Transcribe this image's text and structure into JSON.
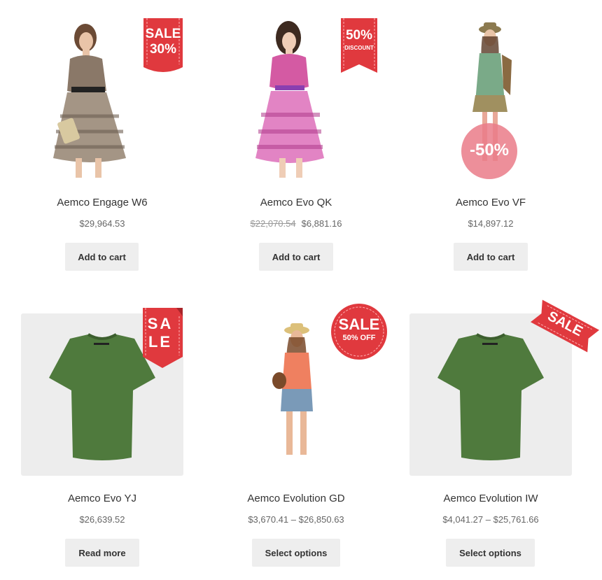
{
  "products": [
    {
      "title": "Aemco Engage W6",
      "price": "$29,964.53",
      "button": "Add to cart",
      "badge_line1": "SALE",
      "badge_line2": "30%"
    },
    {
      "title": "Aemco Evo QK",
      "old_price": "$22,070.54",
      "price": "$6,881.16",
      "button": "Add to cart",
      "badge_line1": "50%",
      "badge_line2": "DISCOUNT"
    },
    {
      "title": "Aemco Evo VF",
      "price": "$14,897.12",
      "button": "Add to cart",
      "badge_line1": "-50%"
    },
    {
      "title": "Aemco Evo YJ",
      "price": "$26,639.52",
      "button": "Read more",
      "badge_line1": "SA",
      "badge_line2": "LE"
    },
    {
      "title": "Aemco Evolution GD",
      "price": "$3,670.41 – $26,850.63",
      "button": "Select options",
      "badge_line1": "SALE",
      "badge_line2": "50% OFF"
    },
    {
      "title": "Aemco Evolution IW",
      "price": "$4,041.27 – $25,761.66",
      "button": "Select options",
      "badge_line1": "SALE"
    }
  ],
  "colors": {
    "badge_red": "#e0393e",
    "shirt_green": "#4f7a3d",
    "button_bg": "#eeeeee"
  }
}
